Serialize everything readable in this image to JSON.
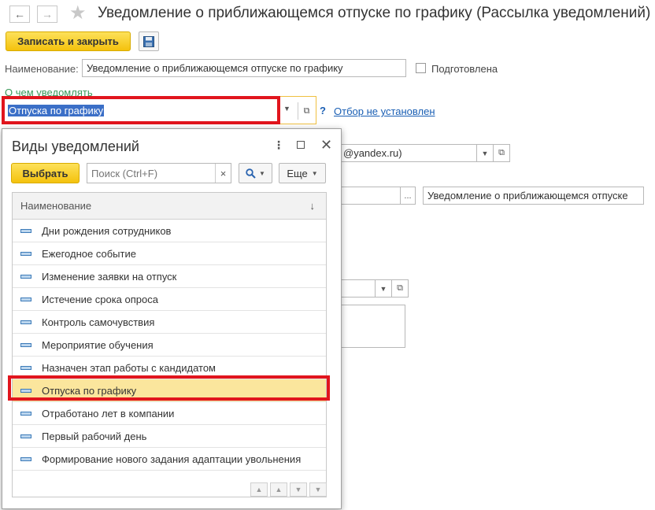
{
  "header": {
    "back_icon": "arrow-left-icon",
    "forward_icon": "arrow-right-icon",
    "favorite_icon": "star-icon",
    "title": "Уведомление о приближающемся отпуске по графику (Рассылка уведомлений)"
  },
  "toolbar": {
    "save_close_label": "Записать и закрыть",
    "save_icon": "floppy-disk-icon"
  },
  "form": {
    "name_label": "Наименование:",
    "name_value": "Уведомление о приближающемся отпуске по графику",
    "prepared_label": "Подготовлена",
    "prepared_checked": false,
    "about_link": "О чем уведомлять",
    "type_value": "Отпуска по графику",
    "help_mark": "?",
    "filter_link": "Отбор не установлен",
    "email_fragment": "@yandex.ru)",
    "dots": "...",
    "subject_value": "Уведомление о приближающемся отпуске"
  },
  "popup": {
    "title": "Виды уведомлений",
    "select_label": "Выбрать",
    "search_placeholder": "Поиск (Ctrl+F)",
    "clear_symbol": "×",
    "more_label": "Еще",
    "column_header": "Наименование",
    "sort_symbol": "↓",
    "items": [
      "Дни рождения сотрудников",
      "Ежегодное событие",
      "Изменение заявки на отпуск",
      "Истечение срока опроса",
      "Контроль самочувствия",
      "Мероприятие обучения",
      "Назначен этап работы с кандидатом",
      "Отпуска по графику",
      "Отработано лет в компании",
      "Первый рабочий день",
      "Формирование нового задания адаптации увольнения"
    ],
    "selected_item": "Отпуска по графику"
  },
  "colors": {
    "accent_yellow": "#f4c20d",
    "highlight_red": "#e1151d",
    "selected_row": "#fbe69d",
    "link_blue": "#1a5fb4"
  }
}
